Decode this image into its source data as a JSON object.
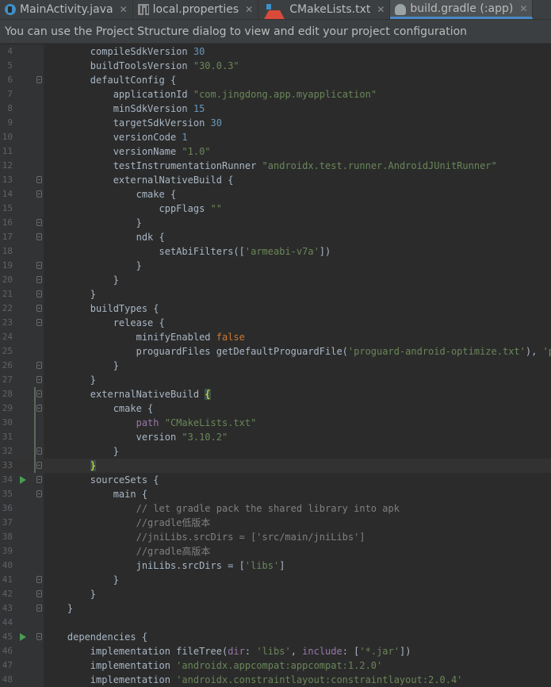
{
  "tabs": [
    {
      "label": "MainActivity.java",
      "icon": "java-class-icon",
      "active": false
    },
    {
      "label": "local.properties",
      "icon": "properties-file-icon",
      "active": false
    },
    {
      "label": "CMakeLists.txt",
      "icon": "cmake-file-icon",
      "active": false
    },
    {
      "label": "build.gradle (:app)",
      "icon": "gradle-file-icon",
      "active": true
    }
  ],
  "notice": "You can use the Project Structure dialog to view and edit your project configuration",
  "lines": [
    {
      "n": "4",
      "tokens": [
        [
          "p",
          "        "
        ],
        [
          "p",
          "compileSdkVersion "
        ],
        [
          "num",
          "30"
        ]
      ]
    },
    {
      "n": "5",
      "tokens": [
        [
          "p",
          "        "
        ],
        [
          "p",
          "buildToolsVersion "
        ],
        [
          "str",
          "\"30.0.3\""
        ]
      ]
    },
    {
      "n": "6",
      "fold": true,
      "tokens": [
        [
          "p",
          "        "
        ],
        [
          "p",
          "defaultConfig {"
        ]
      ]
    },
    {
      "n": "7",
      "tokens": [
        [
          "p",
          "            "
        ],
        [
          "p",
          "applicationId "
        ],
        [
          "str",
          "\"com.jingdong.app.myapplication\""
        ]
      ]
    },
    {
      "n": "8",
      "tokens": [
        [
          "p",
          "            "
        ],
        [
          "p",
          "minSdkVersion "
        ],
        [
          "num",
          "15"
        ]
      ]
    },
    {
      "n": "9",
      "tokens": [
        [
          "p",
          "            "
        ],
        [
          "p",
          "targetSdkVersion "
        ],
        [
          "num",
          "30"
        ]
      ]
    },
    {
      "n": "10",
      "tokens": [
        [
          "p",
          "            "
        ],
        [
          "p",
          "versionCode "
        ],
        [
          "num",
          "1"
        ]
      ]
    },
    {
      "n": "11",
      "tokens": [
        [
          "p",
          "            "
        ],
        [
          "p",
          "versionName "
        ],
        [
          "str",
          "\"1.0\""
        ]
      ]
    },
    {
      "n": "12",
      "tokens": [
        [
          "p",
          "            "
        ],
        [
          "p",
          "testInstrumentationRunner "
        ],
        [
          "str",
          "\"androidx.test.runner.AndroidJUnitRunner\""
        ]
      ]
    },
    {
      "n": "13",
      "fold": true,
      "tokens": [
        [
          "p",
          "            "
        ],
        [
          "p",
          "externalNativeBuild {"
        ]
      ]
    },
    {
      "n": "14",
      "fold": true,
      "tokens": [
        [
          "p",
          "                "
        ],
        [
          "p",
          "cmake {"
        ]
      ]
    },
    {
      "n": "15",
      "tokens": [
        [
          "p",
          "                    "
        ],
        [
          "p",
          "cppFlags "
        ],
        [
          "str",
          "\"\""
        ]
      ]
    },
    {
      "n": "16",
      "fold": true,
      "tokens": [
        [
          "p",
          "                "
        ],
        [
          "p",
          "}"
        ]
      ]
    },
    {
      "n": "17",
      "fold": true,
      "tokens": [
        [
          "p",
          "                "
        ],
        [
          "p",
          "ndk {"
        ]
      ]
    },
    {
      "n": "18",
      "tokens": [
        [
          "p",
          "                    "
        ],
        [
          "p",
          "setAbiFilters(["
        ],
        [
          "str",
          "'armeabi-v7a'"
        ],
        [
          "p",
          "])"
        ]
      ]
    },
    {
      "n": "19",
      "fold": true,
      "tokens": [
        [
          "p",
          "                "
        ],
        [
          "p",
          "}"
        ]
      ]
    },
    {
      "n": "20",
      "fold": true,
      "tokens": [
        [
          "p",
          "            "
        ],
        [
          "p",
          "}"
        ]
      ]
    },
    {
      "n": "21",
      "fold": true,
      "tokens": [
        [
          "p",
          "        "
        ],
        [
          "p",
          "}"
        ]
      ]
    },
    {
      "n": "22",
      "fold": true,
      "tokens": [
        [
          "p",
          "        "
        ],
        [
          "p",
          "buildTypes {"
        ]
      ]
    },
    {
      "n": "23",
      "fold": true,
      "tokens": [
        [
          "p",
          "            "
        ],
        [
          "p",
          "release {"
        ]
      ]
    },
    {
      "n": "24",
      "tokens": [
        [
          "p",
          "                "
        ],
        [
          "p",
          "minifyEnabled "
        ],
        [
          "kw",
          "false"
        ]
      ]
    },
    {
      "n": "25",
      "tokens": [
        [
          "p",
          "                "
        ],
        [
          "p",
          "proguardFiles getDefaultProguardFile("
        ],
        [
          "str",
          "'proguard-android-optimize.txt'"
        ],
        [
          "p",
          "), "
        ],
        [
          "str",
          "'proguard"
        ]
      ]
    },
    {
      "n": "26",
      "fold": true,
      "tokens": [
        [
          "p",
          "            "
        ],
        [
          "p",
          "}"
        ]
      ]
    },
    {
      "n": "27",
      "fold": true,
      "tokens": [
        [
          "p",
          "        "
        ],
        [
          "p",
          "}"
        ]
      ]
    },
    {
      "n": "28",
      "fold": true,
      "vcs": true,
      "tokens": [
        [
          "p",
          "        "
        ],
        [
          "p",
          "externalNativeBuild "
        ],
        [
          "brace",
          "{"
        ]
      ]
    },
    {
      "n": "29",
      "fold": true,
      "vcs": true,
      "tokens": [
        [
          "p",
          "            "
        ],
        [
          "p",
          "cmake {"
        ]
      ]
    },
    {
      "n": "30",
      "vcs": true,
      "tokens": [
        [
          "p",
          "                "
        ],
        [
          "prop",
          "path "
        ],
        [
          "str",
          "\"CMakeLists.txt\""
        ]
      ]
    },
    {
      "n": "31",
      "vcs": true,
      "tokens": [
        [
          "p",
          "                "
        ],
        [
          "p",
          "version "
        ],
        [
          "str",
          "\"3.10.2\""
        ]
      ]
    },
    {
      "n": "32",
      "fold": true,
      "vcs": true,
      "tokens": [
        [
          "p",
          "            "
        ],
        [
          "p",
          "}"
        ]
      ]
    },
    {
      "n": "33",
      "fold": true,
      "vcs": true,
      "current": true,
      "tokens": [
        [
          "p",
          "        "
        ],
        [
          "brace",
          "}"
        ]
      ]
    },
    {
      "n": "34",
      "fold": true,
      "run": true,
      "tokens": [
        [
          "p",
          "        "
        ],
        [
          "p",
          "sourceSets {"
        ]
      ]
    },
    {
      "n": "35",
      "fold": true,
      "tokens": [
        [
          "p",
          "            "
        ],
        [
          "p",
          "main {"
        ]
      ]
    },
    {
      "n": "36",
      "tokens": [
        [
          "p",
          "                "
        ],
        [
          "cm",
          "// let gradle pack the shared library into apk"
        ]
      ]
    },
    {
      "n": "37",
      "tokens": [
        [
          "p",
          "                "
        ],
        [
          "cm",
          "//gradle低版本"
        ]
      ]
    },
    {
      "n": "38",
      "tokens": [
        [
          "p",
          "                "
        ],
        [
          "cm",
          "//jniLibs.srcDirs = ['src/main/jniLibs']"
        ]
      ]
    },
    {
      "n": "39",
      "tokens": [
        [
          "p",
          "                "
        ],
        [
          "cm",
          "//gradle高版本"
        ]
      ]
    },
    {
      "n": "40",
      "tokens": [
        [
          "p",
          "                "
        ],
        [
          "p",
          "jniLibs.srcDirs = ["
        ],
        [
          "str",
          "'libs'"
        ],
        [
          "p",
          "]"
        ]
      ]
    },
    {
      "n": "41",
      "fold": true,
      "tokens": [
        [
          "p",
          "            "
        ],
        [
          "p",
          "}"
        ]
      ]
    },
    {
      "n": "42",
      "fold": true,
      "tokens": [
        [
          "p",
          "        "
        ],
        [
          "p",
          "}"
        ]
      ]
    },
    {
      "n": "43",
      "fold": true,
      "tokens": [
        [
          "p",
          "    "
        ],
        [
          "p",
          "}"
        ]
      ]
    },
    {
      "n": "44",
      "tokens": []
    },
    {
      "n": "45",
      "fold": true,
      "run": true,
      "tokens": [
        [
          "p",
          "    "
        ],
        [
          "p",
          "dependencies {"
        ]
      ]
    },
    {
      "n": "46",
      "tokens": [
        [
          "p",
          "        "
        ],
        [
          "p",
          "implementation fileTree("
        ],
        [
          "prop",
          "dir"
        ],
        [
          "p",
          ": "
        ],
        [
          "str",
          "'libs'"
        ],
        [
          "p",
          ", "
        ],
        [
          "prop",
          "include"
        ],
        [
          "p",
          ": ["
        ],
        [
          "str",
          "'*.jar'"
        ],
        [
          "p",
          "])"
        ]
      ]
    },
    {
      "n": "47",
      "tokens": [
        [
          "p",
          "        "
        ],
        [
          "p",
          "implementation "
        ],
        [
          "str",
          "'androidx.appcompat:appcompat:1.2.0'"
        ]
      ]
    },
    {
      "n": "48",
      "tokens": [
        [
          "p",
          "        "
        ],
        [
          "p",
          "implementation "
        ],
        [
          "str",
          "'androidx.constraintlayout:constraintlayout:2.0.4'"
        ]
      ]
    }
  ]
}
